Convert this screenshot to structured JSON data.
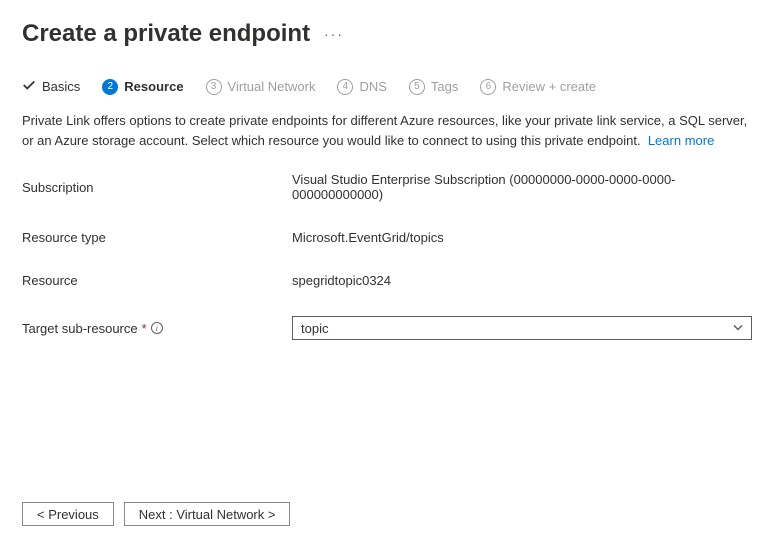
{
  "header": {
    "title": "Create a private endpoint"
  },
  "tabs": {
    "basics": "Basics",
    "resource": "Resource",
    "virtual_network": "Virtual Network",
    "dns": "DNS",
    "tags": "Tags",
    "review": "Review + create"
  },
  "description": {
    "text": "Private Link offers options to create private endpoints for different Azure resources, like your private link service, a SQL server, or an Azure storage account. Select which resource you would like to connect to using this private endpoint.",
    "learn_more": "Learn more"
  },
  "fields": {
    "subscription": {
      "label": "Subscription",
      "value": "Visual Studio Enterprise Subscription (00000000-0000-0000-0000-000000000000)"
    },
    "resource_type": {
      "label": "Resource type",
      "value": "Microsoft.EventGrid/topics"
    },
    "resource": {
      "label": "Resource",
      "value": "spegridtopic0324"
    },
    "target_sub_resource": {
      "label": "Target sub-resource",
      "value": "topic"
    }
  },
  "footer": {
    "previous": "< Previous",
    "next": "Next : Virtual Network >"
  }
}
